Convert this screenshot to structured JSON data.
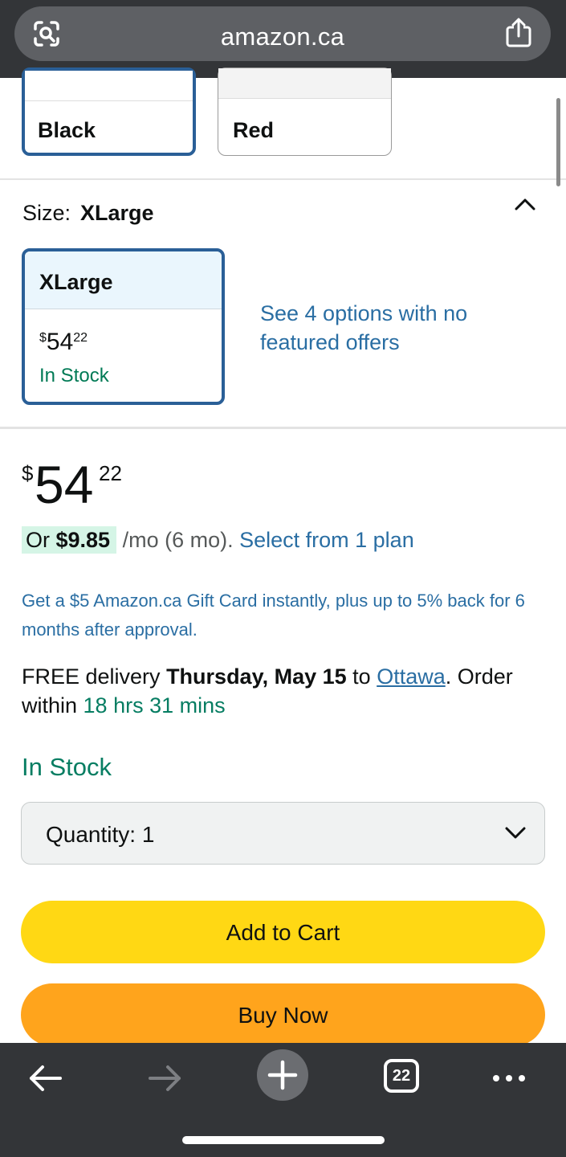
{
  "browser": {
    "url": "amazon.ca",
    "tab_count": "22",
    "icons": [
      "lens-icon",
      "share-icon",
      "back-arrow-icon",
      "forward-arrow-icon",
      "new-tab-plus-icon",
      "tabs-icon",
      "more-icon"
    ]
  },
  "colors": {
    "black_label": "Black",
    "red_label": "Red"
  },
  "size": {
    "label": "Size:",
    "selected": "XLarge",
    "card_title": "XLarge",
    "card_price_currency": "$",
    "card_price_whole": "54",
    "card_price_fraction": "22",
    "card_stock": "In Stock",
    "see_options": "See 4 options with no featured offers"
  },
  "price": {
    "currency": "$",
    "whole": "54",
    "fraction": "22"
  },
  "monthly": {
    "or_text": "Or ",
    "amount": "$9.85",
    "term": " /mo (6 mo). ",
    "link": "Select from 1 plan"
  },
  "gift_offer": "Get a $5 Amazon.ca Gift Card instantly, plus up to 5% back for 6 months after approval.",
  "delivery": {
    "prefix": "FREE delivery ",
    "date": "Thursday, May 15",
    "to": " to ",
    "location": "Ottawa",
    "order_within": ". Order within ",
    "countdown": "18 hrs 31 mins"
  },
  "stock_status": "In Stock",
  "quantity": {
    "label": "Quantity:",
    "value": "1"
  },
  "buttons": {
    "add_to_cart": "Add to Cart",
    "buy_now": "Buy Now"
  },
  "theme": {
    "selected_border": "#2a5f97",
    "link_blue": "#2a6ea3",
    "stock_green": "#067d62",
    "cart_yellow": "#ffd814",
    "buy_orange": "#ffa41c"
  }
}
